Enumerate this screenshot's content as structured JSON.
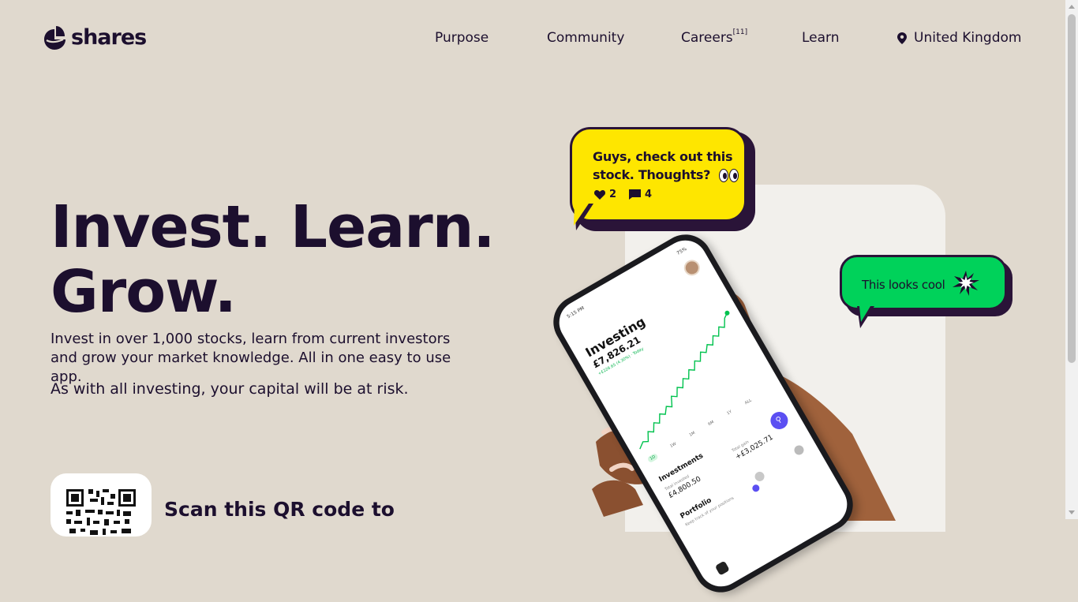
{
  "brand": {
    "name": "shares",
    "logo_icon": "shares-logo-icon"
  },
  "nav": {
    "items": [
      {
        "label": "Purpose"
      },
      {
        "label": "Community"
      },
      {
        "label": "Careers",
        "badge": "[11]"
      },
      {
        "label": "Learn"
      }
    ],
    "region": {
      "label": "United Kingdom",
      "icon": "location-pin-icon"
    }
  },
  "hero": {
    "headline_line1": "Invest. Learn.",
    "headline_line2": "Grow.",
    "description": "Invest in over 1,000 stocks, learn from current investors and grow your market knowledge. All in one easy to use app.",
    "risk_warning": "As with all investing, your capital will be at risk.",
    "qr_cta": "Scan this QR code to"
  },
  "bubbles": {
    "yellow": {
      "text": "Guys, check out this stock. Thoughts?",
      "likes": "2",
      "comments": "4",
      "color": "#fee600"
    },
    "green": {
      "text": "This looks cool",
      "color": "#00d25a"
    }
  },
  "phone": {
    "time": "5:15 PM",
    "battery": "75%",
    "title": "Investing",
    "value": "£7,826.21",
    "change": "+£226.65 (4.30%) · Today",
    "ranges": [
      "1D",
      "1W",
      "1M",
      "6M",
      "1Y",
      "ALL"
    ],
    "investments_label": "Investments",
    "total_invested_label": "Total invested",
    "total_invested": "£4,800.50",
    "total_gain_label": "Total gain",
    "total_gain": "+£3,025.71",
    "portfolio_label": "Portfolio",
    "portfolio_sub": "Keep track of your positions"
  },
  "colors": {
    "background": "#e0d9ce",
    "text": "#1c0f2e",
    "accent_purple": "#5b4ff2",
    "chart_green": "#00c24e"
  }
}
